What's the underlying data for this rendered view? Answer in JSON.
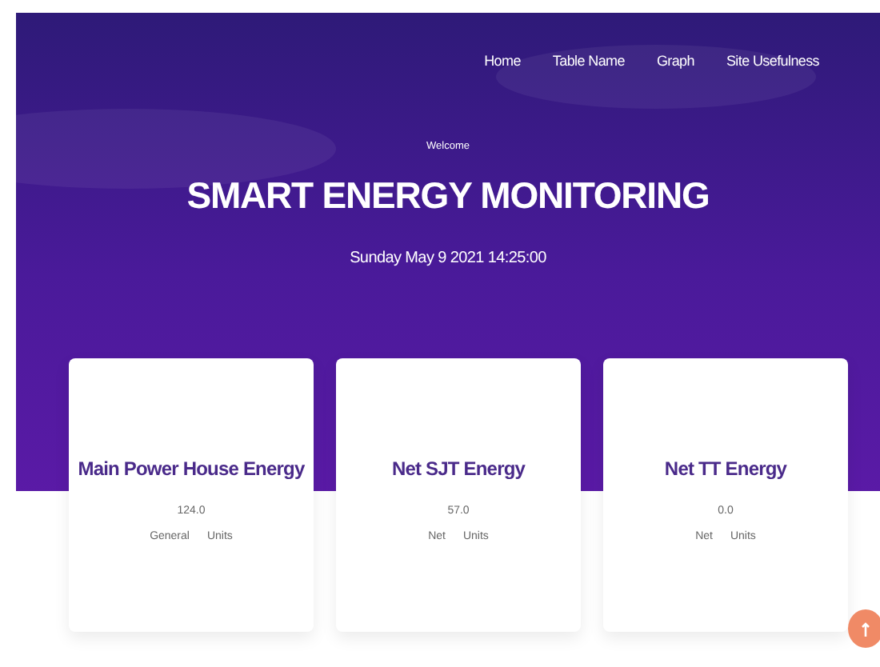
{
  "nav": [
    {
      "label": "Home"
    },
    {
      "label": "Table Name"
    },
    {
      "label": "Graph"
    },
    {
      "label": "Site Usefulness"
    }
  ],
  "hero": {
    "greeting": "Welcome",
    "title": "SMART ENERGY MONITORING",
    "datetime": "Sunday May 9 2021 14:25:00"
  },
  "cards": [
    {
      "title": "Main Power House Energy",
      "value": "124.0",
      "label": "General",
      "unit": "Units"
    },
    {
      "title": "Net SJT Energy",
      "value": "57.0",
      "label": "Net",
      "unit": "Units"
    },
    {
      "title": "Net TT Energy",
      "value": "0.0",
      "label": "Net",
      "unit": "Units"
    }
  ]
}
